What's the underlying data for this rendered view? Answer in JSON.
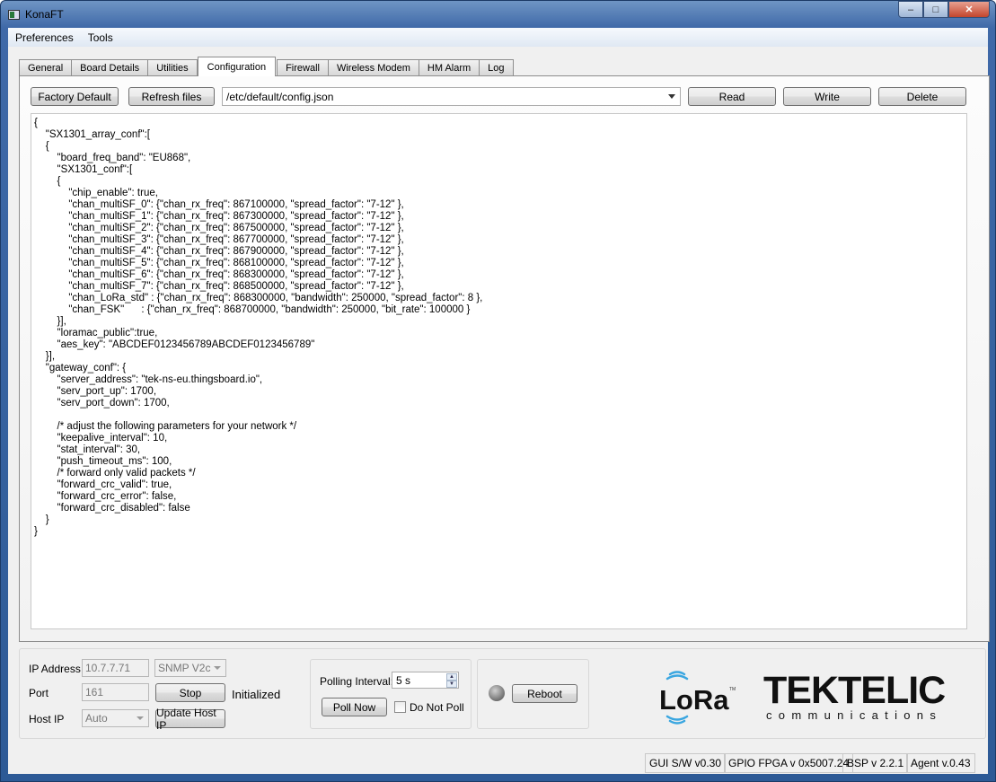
{
  "window": {
    "title": "KonaFT",
    "minimize": "–",
    "maximize": "□",
    "close": "✕"
  },
  "menu": [
    "Preferences",
    "Tools"
  ],
  "tabs": [
    {
      "label": "General"
    },
    {
      "label": "Board Details"
    },
    {
      "label": "Utilities"
    },
    {
      "label": "Configuration",
      "active": true
    },
    {
      "label": "Firewall"
    },
    {
      "label": "Wireless Modem"
    },
    {
      "label": "HM Alarm"
    },
    {
      "label": "Log"
    }
  ],
  "toolbar": {
    "factory_default": "Factory Default",
    "refresh_files": "Refresh files",
    "file_path": "/etc/default/config.json",
    "read": "Read",
    "write": "Write",
    "delete": "Delete"
  },
  "editor": {
    "lines": [
      "{",
      "    \"SX1301_array_conf\":[",
      "    {",
      "        \"board_freq_band\": \"EU868\",",
      "        \"SX1301_conf\":[",
      "        {",
      "            \"chip_enable\": true,",
      "            \"chan_multiSF_0\": {\"chan_rx_freq\": 867100000, \"spread_factor\": \"7-12\" },",
      "            \"chan_multiSF_1\": {\"chan_rx_freq\": 867300000, \"spread_factor\": \"7-12\" },",
      "            \"chan_multiSF_2\": {\"chan_rx_freq\": 867500000, \"spread_factor\": \"7-12\" },",
      "            \"chan_multiSF_3\": {\"chan_rx_freq\": 867700000, \"spread_factor\": \"7-12\" },",
      "            \"chan_multiSF_4\": {\"chan_rx_freq\": 867900000, \"spread_factor\": \"7-12\" },",
      "            \"chan_multiSF_5\": {\"chan_rx_freq\": 868100000, \"spread_factor\": \"7-12\" },",
      "            \"chan_multiSF_6\": {\"chan_rx_freq\": 868300000, \"spread_factor\": \"7-12\" },",
      "            \"chan_multiSF_7\": {\"chan_rx_freq\": 868500000, \"spread_factor\": \"7-12\" },",
      "            \"chan_LoRa_std\" : {\"chan_rx_freq\": 868300000, \"bandwidth\": 250000, \"spread_factor\": 8 },",
      "            \"chan_FSK\"      : {\"chan_rx_freq\": 868700000, \"bandwidth\": 250000, \"bit_rate\": 100000 }",
      "        }],",
      "        \"loramac_public\":true,",
      "        \"aes_key\": \"ABCDEF0123456789ABCDEF0123456789\"",
      "    }],",
      "    \"gateway_conf\": {",
      "        \"server_address\": \"tek-ns-eu.thingsboard.io\",",
      "        \"serv_port_up\": 1700,",
      "        \"serv_port_down\": 1700,",
      "",
      "        /* adjust the following parameters for your network */",
      "        \"keepalive_interval\": 10,",
      "        \"stat_interval\": 30,",
      "        \"push_timeout_ms\": 100,",
      "        /* forward only valid packets */",
      "        \"forward_crc_valid\": true,",
      "        \"forward_crc_error\": false,",
      "        \"forward_crc_disabled\": false",
      "    }",
      "}"
    ]
  },
  "connection": {
    "ip_label": "IP Address",
    "ip_value": "10.7.7.71",
    "protocol": "SNMP V2c",
    "port_label": "Port",
    "port_value": "161",
    "stop": "Stop",
    "state": "Initialized",
    "host_label": "Host IP",
    "host_value": "Auto",
    "update_host": "Update Host IP"
  },
  "polling": {
    "label": "Polling Interval:",
    "value": "5 s",
    "poll_now": "Poll Now",
    "do_not_poll": "Do Not Poll",
    "do_not_poll_checked": false
  },
  "reboot": {
    "label": "Reboot",
    "led": "off"
  },
  "logos": {
    "lora": "LoRa",
    "tm": "TM",
    "tektelic": "TEKTELIC",
    "communications": "communications",
    "lora_wave_color": "#3aa6e0"
  },
  "statusbar": [
    "GUI S/W v0.30",
    "GPIO FPGA v 0x5007.24",
    "BSP v 2.2.1",
    "Agent v.0.43"
  ]
}
